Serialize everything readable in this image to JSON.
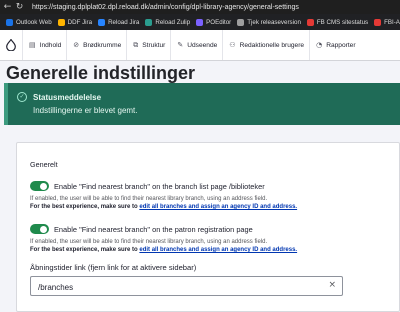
{
  "browser": {
    "url": "https://staging.dplplat02.dpl.reload.dk/admin/config/dpl-library-agency/general-settings",
    "back_icon": "arrow-left-icon",
    "reload_icon": "reload-icon",
    "bookmarks": [
      {
        "label": "Outlook Web",
        "color": "#1a73e8"
      },
      {
        "label": "DDF Jira",
        "color": "#ffb400"
      },
      {
        "label": "Reload Jira",
        "color": "#2684ff"
      },
      {
        "label": "Reload Zulip",
        "color": "#2a9d8f"
      },
      {
        "label": "POEditor",
        "color": "#7b61ff"
      },
      {
        "label": "Tjek releaseversion",
        "color": "#9e9e9e"
      },
      {
        "label": "FB CMS sitestatus",
        "color": "#e53935"
      },
      {
        "label": "FBI-A",
        "color": "#e53935"
      }
    ]
  },
  "toolbar": {
    "items": [
      {
        "label": "Indhold",
        "icon": "document-icon"
      },
      {
        "label": "Brødkrumme",
        "icon": "breadcrumb-icon"
      },
      {
        "label": "Struktur",
        "icon": "structure-icon"
      },
      {
        "label": "Udseende",
        "icon": "appearance-icon"
      },
      {
        "label": "Redaktionelle brugere",
        "icon": "users-icon"
      },
      {
        "label": "Rapporter",
        "icon": "reports-icon"
      }
    ]
  },
  "page": {
    "title": "Generelle indstillinger"
  },
  "status": {
    "title": "Statusmeddelelse",
    "message": "Indstillingerne er blevet gemt."
  },
  "form": {
    "legend": "Generelt",
    "toggle1": {
      "label": "Enable \"Find nearest branch\" on the branch list page /biblioteker",
      "description": "If enabled, the user will be able to find their nearest library branch, using an address field.",
      "note_prefix": "For the best experience, make sure to ",
      "note_link": "edit all branches and assign an agency ID and address.",
      "enabled": true
    },
    "toggle2": {
      "label": "Enable \"Find nearest branch\" on the patron registration page",
      "description": "If enabled, the user will be able to find their nearest library branch, using an address field.",
      "note_prefix": "For the best experience, make sure to ",
      "note_link": "edit all branches and assign an agency ID and address.",
      "enabled": true
    },
    "opening_hours": {
      "label": "Åbningstider link (fjern link for at aktivere sidebar)",
      "value": "/branches",
      "clear_icon": "close-icon"
    }
  }
}
